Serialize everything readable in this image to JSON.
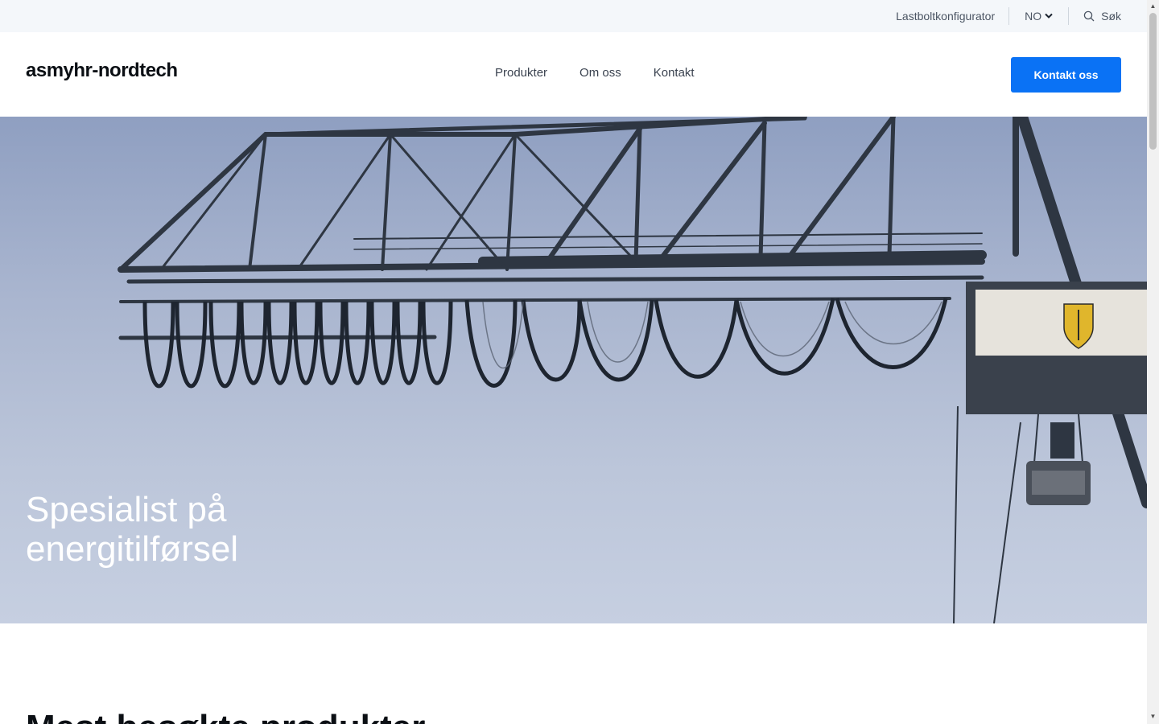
{
  "utility": {
    "configurator_label": "Lastboltkonfigurator",
    "language_label": "NO",
    "search_label": "Søk"
  },
  "header": {
    "logo_text": "asmyhr-nordtech",
    "nav": [
      "Produkter",
      "Om oss",
      "Kontakt"
    ],
    "cta_label": "Kontakt oss"
  },
  "hero": {
    "title_line1": "Spesialist på",
    "title_line2": "energitilførsel",
    "image_alt": "crane-with-festoon-cables"
  },
  "next_section": {
    "heading_peek": "Mest besøkte produkter"
  },
  "colors": {
    "accent": "#0a72f5",
    "utility_bg": "#f4f7fa",
    "sky": "#a9b5cf"
  },
  "icons": [
    "chevron-down-icon",
    "search-icon"
  ]
}
